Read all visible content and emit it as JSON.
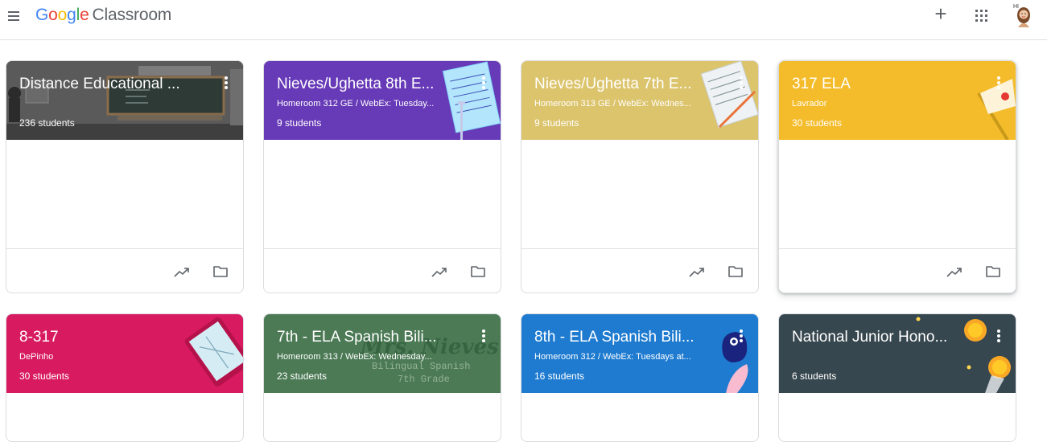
{
  "header": {
    "logo_brand": [
      "G",
      "o",
      "o",
      "g",
      "l",
      "e"
    ],
    "logo_product": "Classroom",
    "plus_glyph": "+",
    "icons": [
      "menu-icon",
      "plus-icon",
      "apps-grid-icon",
      "avatar"
    ]
  },
  "classes": [
    {
      "title": "Distance Educational ...",
      "subtitle": "",
      "students": "236 students",
      "color": "#4a4a4a"
    },
    {
      "title": "Nieves/Ughetta 8th E...",
      "subtitle": "Homeroom 312 GE / WebEx: Tuesday...",
      "students": "9 students",
      "color": "#673ab7"
    },
    {
      "title": "Nieves/Ughetta 7th E...",
      "subtitle": "Homeroom 313 GE / WebEx: Wednes...",
      "students": "9 students",
      "color": "#dcc46c"
    },
    {
      "title": "317 ELA",
      "subtitle": "Lavrador",
      "students": "30 students",
      "color": "#f4bc2a"
    },
    {
      "title": "8-317",
      "subtitle": "DePinho",
      "students": "30 students",
      "color": "#d81b60"
    },
    {
      "title": "7th - ELA Spanish Bili...",
      "subtitle": "Homeroom 313 / WebEx: Wednesday...",
      "students": "23 students",
      "color": "#4b7a55",
      "watermark": [
        "Mrs. Nieves",
        "Bilingual Spanish",
        "7th Grade"
      ]
    },
    {
      "title": "8th - ELA Spanish Bili...",
      "subtitle": "Homeroom 312 / WebEx: Tuesdays at...",
      "students": "16 students",
      "color": "#1e7bd0"
    },
    {
      "title": "National Junior Hono...",
      "subtitle": "",
      "students": "6 students",
      "color": "#37474f"
    }
  ],
  "card_icons": [
    "trending-up-icon",
    "folder-icon"
  ]
}
